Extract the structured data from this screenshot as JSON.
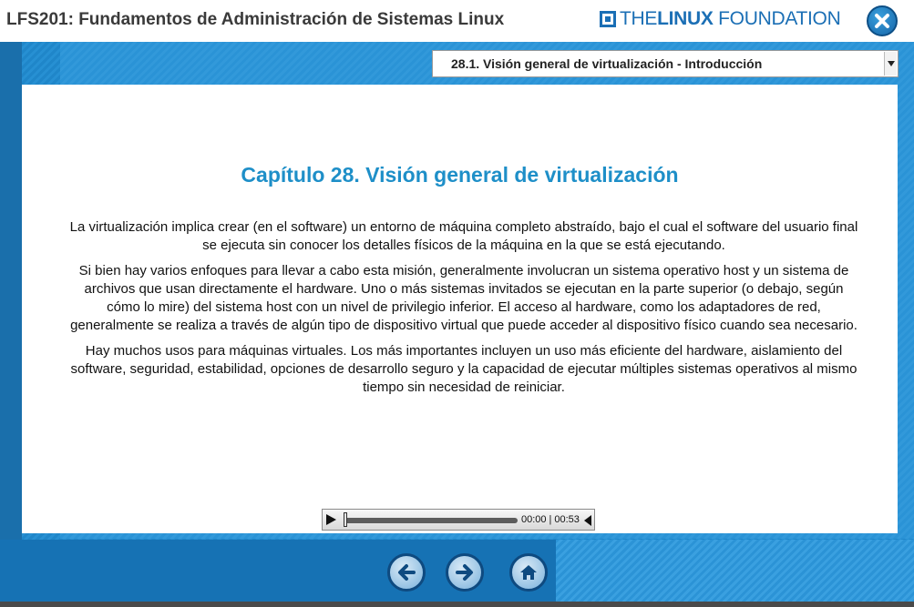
{
  "header": {
    "course_title": "LFS201: Fundamentos de Administración de Sistemas Linux",
    "logo": {
      "prefix": "THE",
      "bold": "LINUX",
      "suffix": " FOUNDATION"
    },
    "close_icon": "close-x-icon"
  },
  "section_select": {
    "selected": "28.1. Visión general de virtualización - Introducción",
    "arrow_icon": "dropdown-arrow-icon"
  },
  "content": {
    "chapter_title": "Capítulo 28. Visión general de virtualización",
    "paragraphs": [
      "La virtualización implica crear (en el software) un entorno de máquina completo abstraído, bajo el cual el software del usuario final se ejecuta sin conocer los detalles físicos de la máquina en la que se está ejecutando.",
      "Si bien hay varios enfoques para llevar a cabo esta misión, generalmente involucran un sistema operativo host y un sistema de archivos que usan directamente el hardware. Uno o más sistemas invitados se ejecutan en la parte superior (o debajo, según cómo lo mire) del sistema host con un nivel de privilegio inferior. El acceso al hardware, como los adaptadores de red, generalmente se realiza a través de algún tipo de dispositivo virtual que puede acceder al dispositivo físico cuando sea necesario.",
      "Hay muchos usos para máquinas virtuales. Los más importantes incluyen un uso más eficiente del hardware, aislamiento del software, seguridad, estabilidad, opciones de desarrollo seguro y la capacidad de ejecutar múltiples sistemas operativos al mismo tiempo sin necesidad de reiniciar."
    ]
  },
  "audio_player": {
    "current_time": "00:00",
    "separator": "|",
    "duration": "00:53",
    "progress_fraction": 0.0
  },
  "navigation": {
    "back_icon": "arrow-left-icon",
    "next_icon": "arrow-right-icon",
    "home_icon": "home-icon"
  },
  "colors": {
    "accent_blue": "#1e8fc8",
    "brand_blue": "#1b6fb5",
    "background_blue": "#1f86c9"
  }
}
